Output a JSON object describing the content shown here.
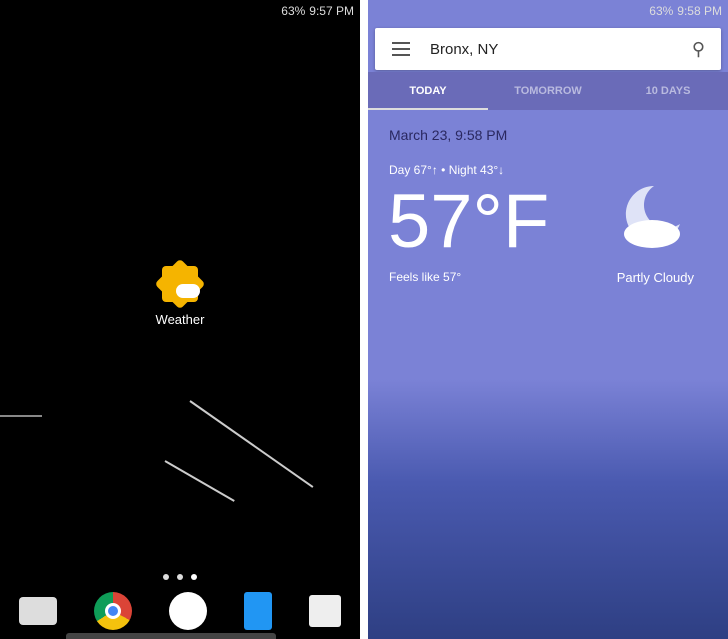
{
  "left": {
    "status": {
      "battery": "63%",
      "time": "9:57 PM"
    },
    "app": {
      "label": "Weather",
      "icon": "google-weather-icon"
    },
    "page_indicator": {
      "pages": 3,
      "current": 3
    },
    "dock": [
      "camera-icon",
      "chrome-icon",
      "app-drawer-icon",
      "contacts-icon",
      "play-store-icon"
    ]
  },
  "right": {
    "status": {
      "battery": "63%",
      "time": "9:58 PM"
    },
    "search": {
      "location": "Bronx, NY"
    },
    "tabs": [
      {
        "label": "TODAY",
        "active": true
      },
      {
        "label": "TOMORROW"
      },
      {
        "label": "10 DAYS"
      }
    ],
    "weather": {
      "date": "March 23, 9:58 PM",
      "day_night": "Day 67°↑ • Night 43°↓",
      "temp": "57°F",
      "feels": "Feels like 57°",
      "condition": "Partly Cloudy",
      "icon": "moon-cloud-icon"
    },
    "colors": {
      "background": "#7b82d6",
      "tabs": "#6a6bb8"
    }
  }
}
